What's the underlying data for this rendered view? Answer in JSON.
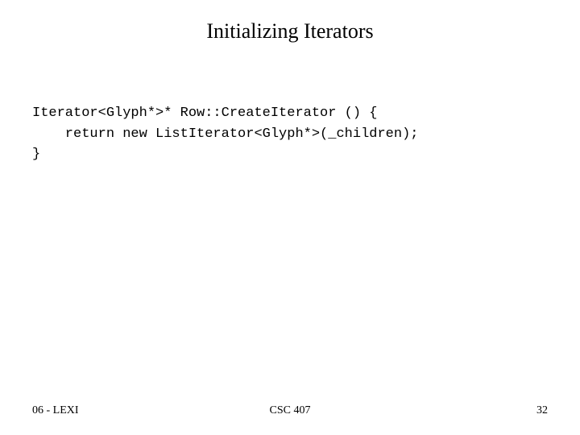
{
  "title": "Initializing Iterators",
  "code": {
    "line1": "Iterator<Glyph*>* Row::CreateIterator () {",
    "line2": "    return new ListIterator<Glyph*>(_children);",
    "line3": "}"
  },
  "footer": {
    "left": "06 - LEXI",
    "center": "CSC 407",
    "right": "32"
  }
}
